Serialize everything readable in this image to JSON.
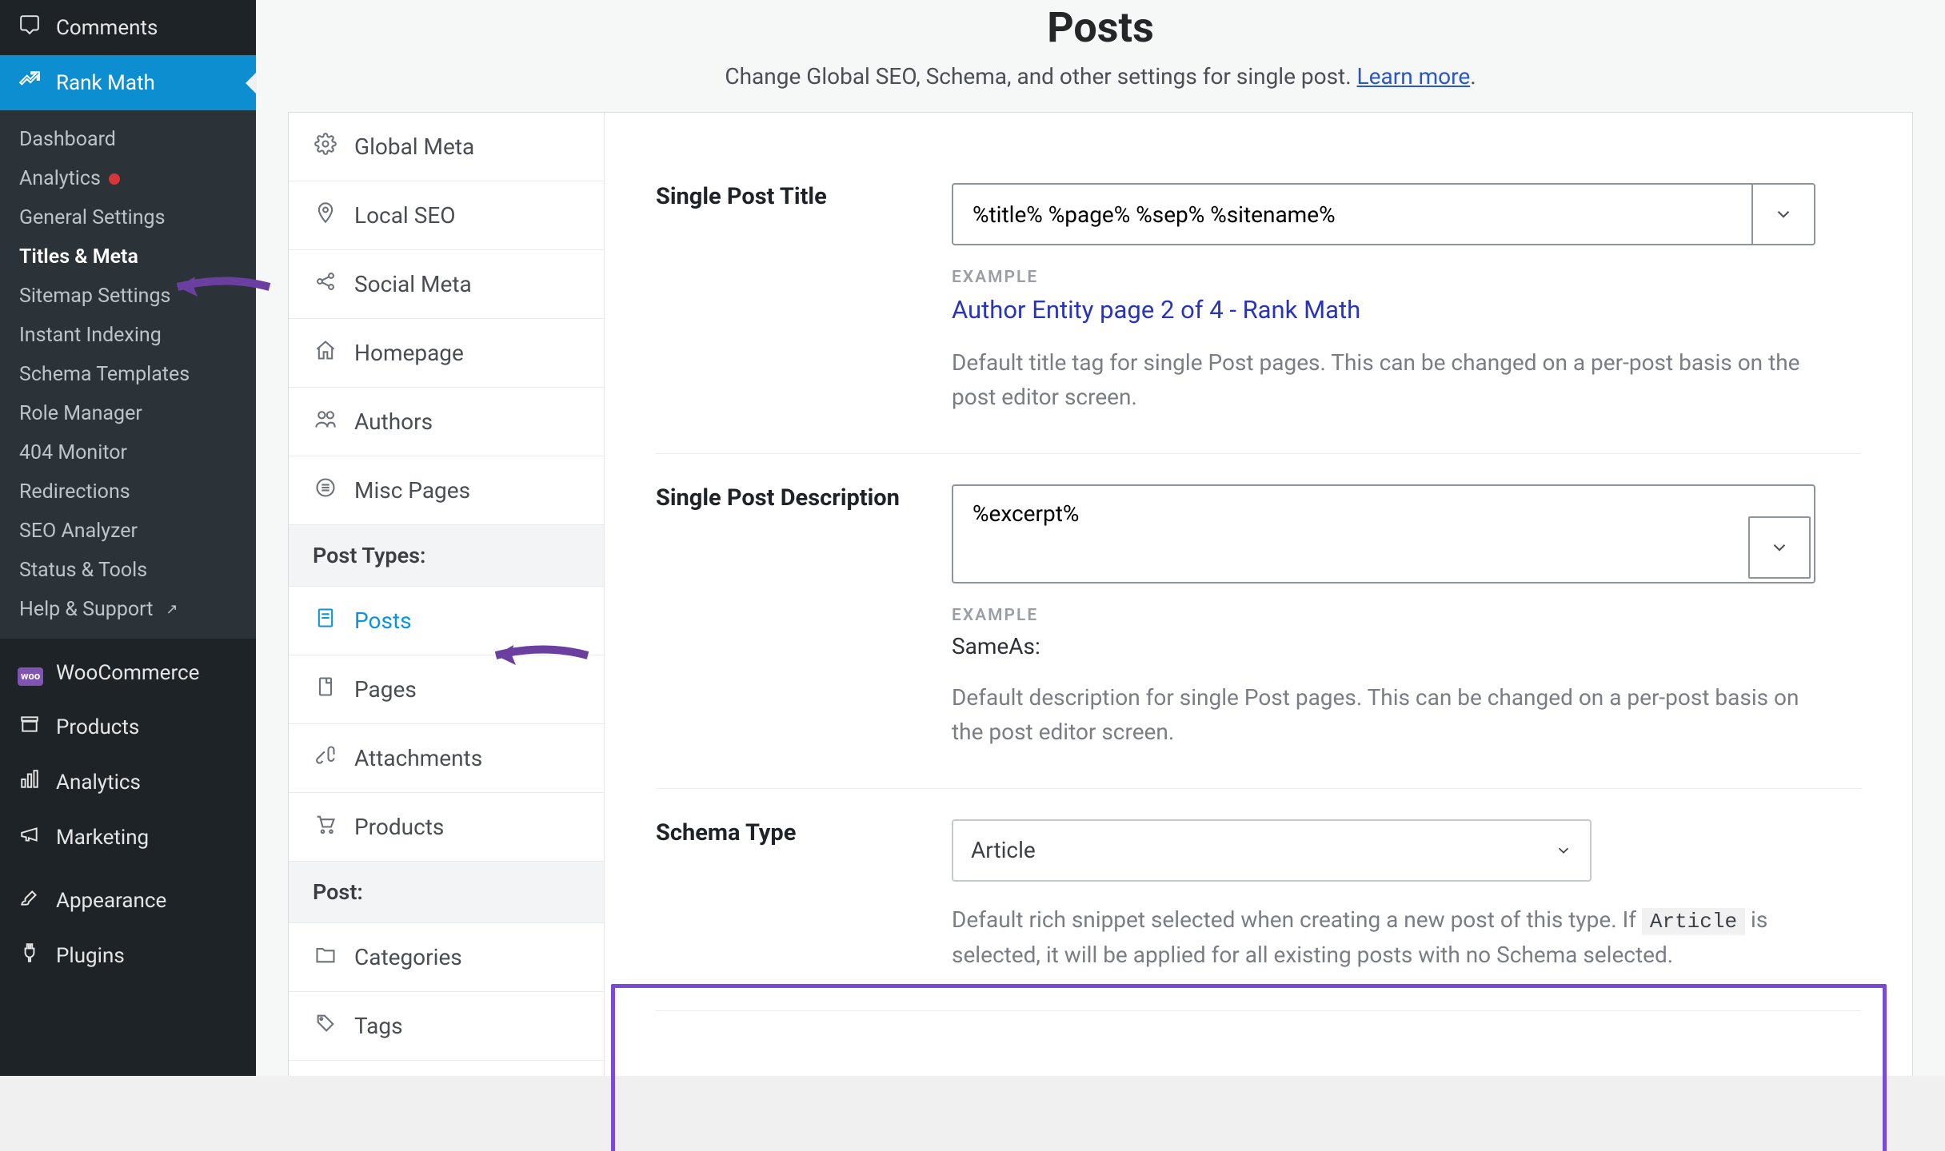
{
  "wpSidebar": {
    "top": [
      {
        "label": "Comments",
        "icon": "comment"
      },
      {
        "label": "Rank Math",
        "icon": "chart-up",
        "active": true
      }
    ],
    "sub": [
      {
        "label": "Dashboard"
      },
      {
        "label": "Analytics",
        "dot": true
      },
      {
        "label": "General Settings"
      },
      {
        "label": "Titles & Meta",
        "bold": true,
        "arrow": true
      },
      {
        "label": "Sitemap Settings"
      },
      {
        "label": "Instant Indexing"
      },
      {
        "label": "Schema Templates"
      },
      {
        "label": "Role Manager"
      },
      {
        "label": "404 Monitor"
      },
      {
        "label": "Redirections"
      },
      {
        "label": "SEO Analyzer"
      },
      {
        "label": "Status & Tools"
      },
      {
        "label": "Help & Support",
        "ext": true
      }
    ],
    "bottom": [
      {
        "label": "WooCommerce",
        "icon": "woo"
      },
      {
        "label": "Products",
        "icon": "archive"
      },
      {
        "label": "Analytics",
        "icon": "bars"
      },
      {
        "label": "Marketing",
        "icon": "megaphone"
      },
      {
        "label": "Appearance",
        "icon": "brush",
        "sepBefore": true
      },
      {
        "label": "Plugins",
        "icon": "plug"
      }
    ]
  },
  "header": {
    "title": "Posts",
    "subtitle": "Change Global SEO, Schema, and other settings for single post. ",
    "learnMore": "Learn more"
  },
  "settingsNav": {
    "items": [
      {
        "label": "Global Meta",
        "icon": "gear"
      },
      {
        "label": "Local SEO",
        "icon": "pin"
      },
      {
        "label": "Social Meta",
        "icon": "share"
      },
      {
        "label": "Homepage",
        "icon": "home"
      },
      {
        "label": "Authors",
        "icon": "users"
      },
      {
        "label": "Misc Pages",
        "icon": "list"
      }
    ],
    "section1": "Post Types:",
    "postTypes": [
      {
        "label": "Posts",
        "icon": "post",
        "active": true,
        "arrow": true
      },
      {
        "label": "Pages",
        "icon": "page"
      },
      {
        "label": "Attachments",
        "icon": "clip"
      },
      {
        "label": "Products",
        "icon": "cart"
      }
    ],
    "section2": "Post:",
    "tax": [
      {
        "label": "Categories",
        "icon": "folder"
      },
      {
        "label": "Tags",
        "icon": "tag"
      }
    ]
  },
  "fields": {
    "title": {
      "label": "Single Post Title",
      "value": "%title% %page% %sep% %sitename%",
      "exampleLabel": "EXAMPLE",
      "example": "Author Entity page 2 of 4 - Rank Math",
      "help": "Default title tag for single Post pages. This can be changed on a per-post basis on the post editor screen."
    },
    "desc": {
      "label": "Single Post Description",
      "value": "%excerpt%",
      "exampleLabel": "EXAMPLE",
      "example": "SameAs:",
      "help": "Default description for single Post pages. This can be changed on a per-post basis on the post editor screen."
    },
    "schema": {
      "label": "Schema Type",
      "value": "Article",
      "help1": "Default rich snippet selected when creating a new post of this type. If ",
      "code": "Article",
      "help2": " is selected, it will be applied for all existing posts with no Schema selected."
    }
  }
}
